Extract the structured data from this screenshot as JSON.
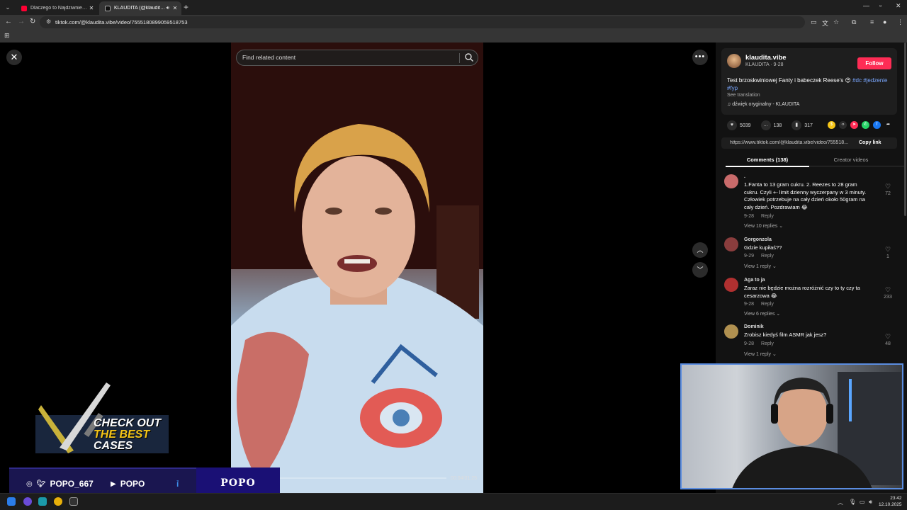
{
  "browser": {
    "tabs": [
      {
        "title": "Dlaczego to Najdziwniejsza inf",
        "active": false
      },
      {
        "title": "KLAUDITA (@klaudita.vibe",
        "active": true
      }
    ],
    "url": "tiktok.com/@klaudita.vibe/video/7555180899059518753"
  },
  "video": {
    "search_placeholder": "Find related content",
    "time": "00:04/01:25",
    "progress": 0.05
  },
  "post": {
    "username": "klaudita.vibe",
    "nickname_date": "KLAUDITA · 9-28",
    "follow_label": "Follow",
    "description": "Test brzoskwiniowej Fanty i babeczek Reese's 😍 ",
    "tags": [
      "#dc",
      "#jedzenie",
      "#fyp"
    ],
    "see_translation": "See translation",
    "sound": "dźwięk oryginalny - KLAUDITA",
    "likes": "5039",
    "comments_count": "138",
    "saves": "317",
    "copy_url": "https://www.tiktok.com/@klaudita.vibe/video/755518...",
    "copy_label": "Copy link",
    "tab_comments": "Comments (138)",
    "tab_creator": "Creator videos"
  },
  "comments": [
    {
      "user": ".",
      "text": "1.Fanta to 13 gram cukru. 2. Reezes to 28 gram cukru. Czyli +- limit dzienny wyczerpany w 3 minuty. Człowiek potrzebuje na cały dzień około 50gram na cały dzień. Pozdrawiam 😂",
      "date": "9-28",
      "reply": "Reply",
      "replies": "View 10 replies",
      "likes": "72",
      "color": "#c96b6b"
    },
    {
      "user": "Gorgonzola",
      "text": "Gdzie kupiłaś??",
      "date": "9-29",
      "reply": "Reply",
      "replies": "View 1 reply",
      "likes": "1",
      "color": "#8a3d3d"
    },
    {
      "user": "Aga to ja",
      "text": "Zaraz nie będzie można rozróżnić czy to ty czy ta cesarzowa 😂",
      "date": "9-28",
      "reply": "Reply",
      "replies": "View 6 replies",
      "likes": "233",
      "color": "#b03030"
    },
    {
      "user": "Dominik",
      "text": "Zrobisz kiedyś film ASMR jak jesz?",
      "date": "9-28",
      "reply": "Reply",
      "replies": "View 1 reply",
      "likes": "48",
      "color": "#b09050"
    }
  ],
  "overlay": {
    "case_line1": "CHECK OUT",
    "case_line2": "THE BEST",
    "case_line3": "CASES",
    "social_handle": "POPO_667",
    "youtube_name": "POPO",
    "brand": "POPO"
  },
  "taskbar": {
    "time": "23:42",
    "date": "12.10.2025"
  },
  "colors": {
    "accent": "#fe2c55",
    "tag": "#7aa7ff",
    "overlay_bar": "#1a1650"
  }
}
